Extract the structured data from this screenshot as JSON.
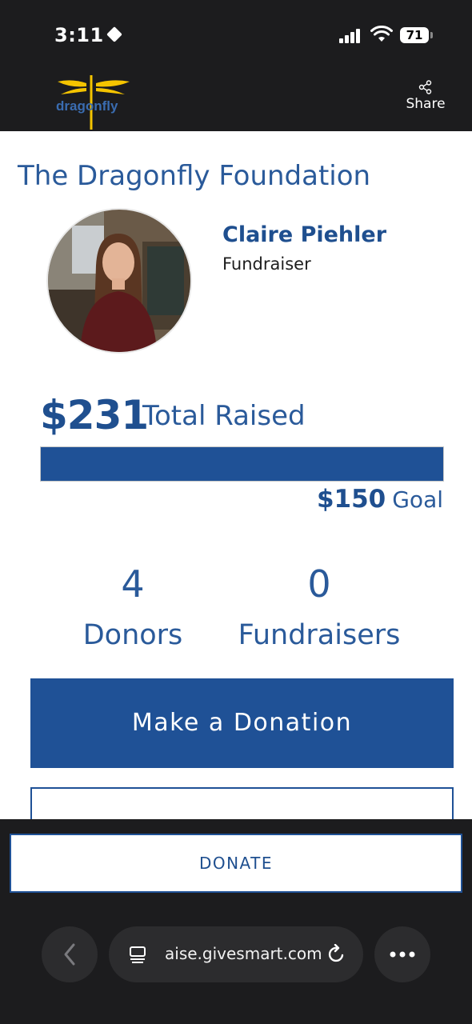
{
  "status_bar": {
    "time": "3:11",
    "battery": "71"
  },
  "header": {
    "logo_text": "dragonfly",
    "share_label": "Share"
  },
  "campaign": {
    "org_title": "The Dragonfly Foundation",
    "fundraiser_name": "Claire Piehler",
    "fundraiser_role": "Fundraiser",
    "raised_amount": "$231",
    "raised_label": "Total Raised",
    "progress_fraction": 1.0,
    "goal_amount": "$150",
    "goal_label": "Goal"
  },
  "stats": [
    {
      "count": "4",
      "label": "Donors"
    },
    {
      "count": "0",
      "label": "Fundraisers"
    }
  ],
  "actions": {
    "make_donation_label": "Make a Donation",
    "donate_label": "DONATE"
  },
  "browser": {
    "url": "aise.givesmart.com"
  },
  "colors": {
    "brand_blue": "#1f5196",
    "header_bg": "#1c1c1e",
    "logo_yellow": "#f5c400"
  }
}
